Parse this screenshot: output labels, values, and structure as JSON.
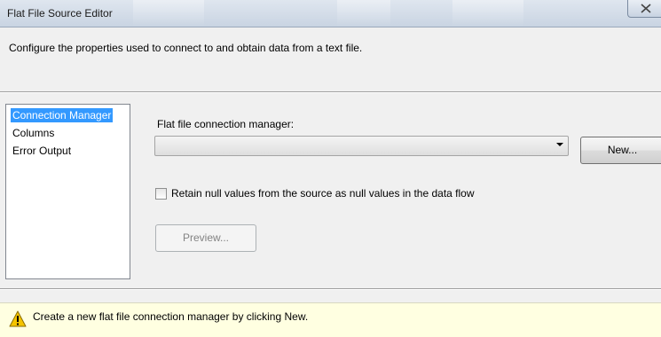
{
  "window": {
    "title": "Flat File Source Editor",
    "close_icon": "close-icon"
  },
  "header": {
    "description": "Configure the properties used to connect to and obtain data from a text file."
  },
  "nav": {
    "items": [
      {
        "label": "Connection Manager",
        "selected": true
      },
      {
        "label": "Columns",
        "selected": false
      },
      {
        "label": "Error Output",
        "selected": false
      }
    ]
  },
  "connection": {
    "label": "Flat file connection manager:",
    "selected_value": "",
    "new_button": "New...",
    "retain_nulls_label": "Retain null values from the source as null values in the data flow",
    "retain_nulls_checked": false,
    "preview_button": "Preview..."
  },
  "status": {
    "icon": "warning-icon",
    "message": "Create a new flat file connection manager by clicking New."
  },
  "colors": {
    "selection": "#3399ff",
    "status_background": "#ffffe1",
    "warning": "#f5c400"
  }
}
